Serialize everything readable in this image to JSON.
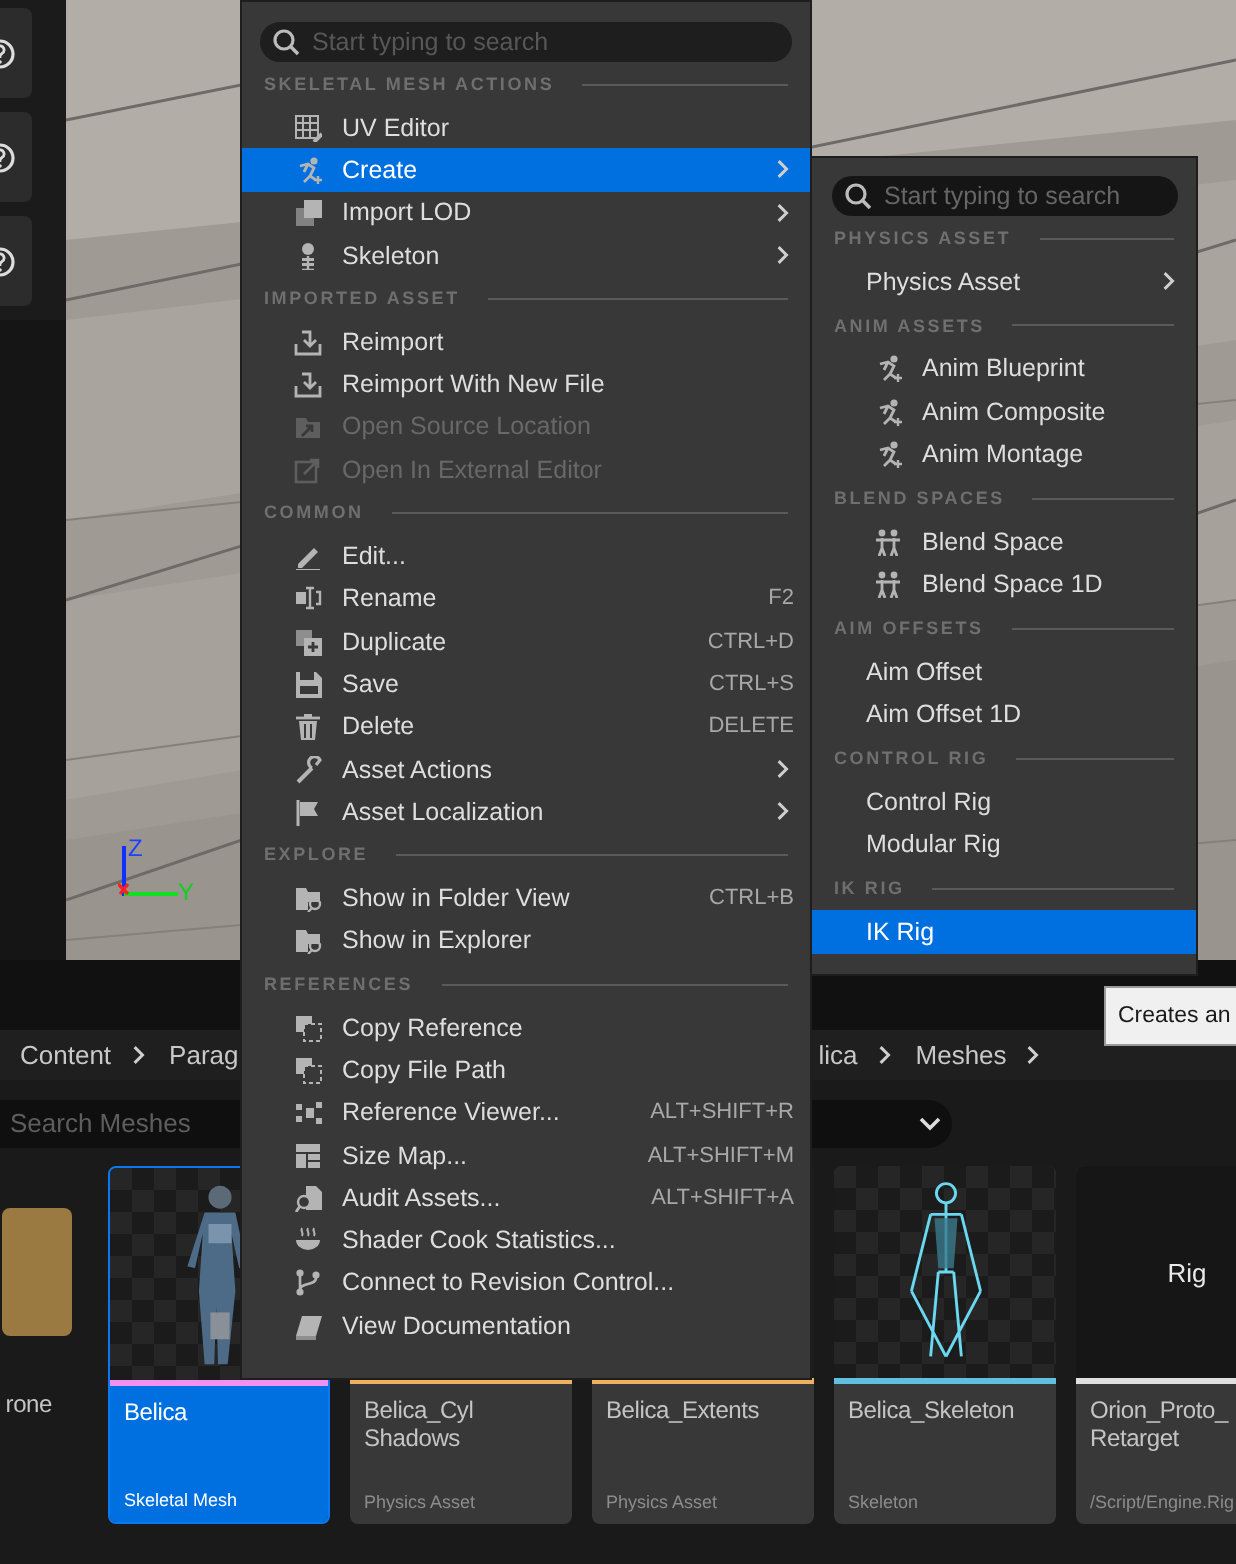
{
  "viewport": {
    "kind": "picture",
    "axis_labels": [
      "Z",
      "Y"
    ]
  },
  "tooltip": "Creates an",
  "breadcrumb": [
    {
      "label": "Content",
      "chevron": true
    },
    {
      "label": "Parag",
      "chevron": false
    },
    {
      "label": "lica",
      "chevron": true
    },
    {
      "label": "Meshes",
      "chevron": true
    }
  ],
  "search": {
    "placeholder": "Search Meshes"
  },
  "assets": [
    {
      "name": "rone",
      "selected": false,
      "thumbnail": {
        "kind": "swatch"
      }
    },
    {
      "name": "Belica",
      "type": "Skeletal Mesh",
      "color": "#f090f0",
      "selected": true,
      "thumbnail": {
        "kind": "figure"
      }
    },
    {
      "name": "Belica_Cyl Shadows",
      "type": "Physics Asset",
      "color": "#f0b060",
      "selected": false,
      "thumbnail": {
        "kind": "hidden"
      }
    },
    {
      "name": "Belica_Extents",
      "type": "Physics Asset",
      "color": "#f0b060",
      "selected": false,
      "thumbnail": {
        "kind": "hidden"
      }
    },
    {
      "name": "Belica_Skeleton",
      "type": "Skeleton",
      "color": "#60c0e0",
      "selected": false,
      "thumbnail": {
        "kind": "skeleton"
      }
    },
    {
      "name": "Orion_Proto_ Retarget",
      "type": "/Script/Engine.Rig",
      "color": "#e0e0e0",
      "selected": false,
      "thumbnail": {
        "kind": "text",
        "text": "Rig"
      }
    }
  ],
  "context_menu": {
    "search": {
      "placeholder": "Start typing to search"
    },
    "sections": [
      {
        "title": "SKELETAL MESH ACTIONS",
        "items": [
          {
            "label": "UV Editor",
            "submenu": false,
            "disabled": false,
            "selected": false
          },
          {
            "label": "Create",
            "submenu": true,
            "disabled": false,
            "selected": true
          },
          {
            "label": "Import LOD",
            "submenu": true,
            "disabled": false,
            "selected": false
          },
          {
            "label": "Skeleton",
            "submenu": true,
            "disabled": false,
            "selected": false
          }
        ]
      },
      {
        "title": "IMPORTED ASSET",
        "items": [
          {
            "label": "Reimport",
            "submenu": false,
            "disabled": false,
            "selected": false
          },
          {
            "label": "Reimport With New File",
            "submenu": false,
            "disabled": false,
            "selected": false
          },
          {
            "label": "Open Source Location",
            "submenu": false,
            "disabled": true,
            "selected": false
          },
          {
            "label": "Open In External Editor",
            "submenu": false,
            "disabled": true,
            "selected": false
          }
        ]
      },
      {
        "title": "COMMON",
        "items": [
          {
            "label": "Edit...",
            "submenu": false,
            "disabled": false,
            "selected": false
          },
          {
            "label": "Rename",
            "shortcut": "F2",
            "submenu": false,
            "disabled": false,
            "selected": false
          },
          {
            "label": "Duplicate",
            "shortcut": "CTRL+D",
            "submenu": false,
            "disabled": false,
            "selected": false
          },
          {
            "label": "Save",
            "shortcut": "CTRL+S",
            "submenu": false,
            "disabled": false,
            "selected": false
          },
          {
            "label": "Delete",
            "shortcut": "DELETE",
            "submenu": false,
            "disabled": false,
            "selected": false
          },
          {
            "label": "Asset Actions",
            "submenu": true,
            "disabled": false,
            "selected": false
          },
          {
            "label": "Asset Localization",
            "submenu": true,
            "disabled": false,
            "selected": false
          }
        ]
      },
      {
        "title": "EXPLORE",
        "items": [
          {
            "label": "Show in Folder View",
            "shortcut": "CTRL+B",
            "submenu": false,
            "disabled": false,
            "selected": false
          },
          {
            "label": "Show in Explorer",
            "submenu": false,
            "disabled": false,
            "selected": false
          }
        ]
      },
      {
        "title": "REFERENCES",
        "items": [
          {
            "label": "Copy Reference",
            "submenu": false,
            "disabled": false,
            "selected": false
          },
          {
            "label": "Copy File Path",
            "submenu": false,
            "disabled": false,
            "selected": false
          },
          {
            "label": "Reference Viewer...",
            "shortcut": "ALT+SHIFT+R",
            "submenu": false,
            "disabled": false,
            "selected": false
          },
          {
            "label": "Size Map...",
            "shortcut": "ALT+SHIFT+M",
            "submenu": false,
            "disabled": false,
            "selected": false
          },
          {
            "label": "Audit Assets...",
            "shortcut": "ALT+SHIFT+A",
            "submenu": false,
            "disabled": false,
            "selected": false
          },
          {
            "label": "Shader Cook Statistics...",
            "submenu": false,
            "disabled": false,
            "selected": false
          },
          {
            "label": "Connect to Revision Control...",
            "submenu": false,
            "disabled": false,
            "selected": false
          },
          {
            "label": "View Documentation",
            "submenu": false,
            "disabled": false,
            "selected": false
          }
        ]
      }
    ]
  },
  "submenu": {
    "search": {
      "placeholder": "Start typing to search"
    },
    "sections": [
      {
        "title": "PHYSICS ASSET",
        "items": [
          {
            "label": "Physics Asset",
            "kind": "plain",
            "submenu": true,
            "selected": false
          }
        ]
      },
      {
        "title": "ANIM ASSETS",
        "items": [
          {
            "label": "Anim Blueprint",
            "kind": "icon",
            "submenu": false,
            "selected": false
          },
          {
            "label": "Anim Composite",
            "kind": "icon",
            "submenu": false,
            "selected": false
          },
          {
            "label": "Anim Montage",
            "kind": "icon",
            "submenu": false,
            "selected": false
          }
        ]
      },
      {
        "title": "BLEND SPACES",
        "items": [
          {
            "label": "Blend Space",
            "kind": "icon",
            "submenu": false,
            "selected": false
          },
          {
            "label": "Blend Space 1D",
            "kind": "icon",
            "submenu": false,
            "selected": false
          }
        ]
      },
      {
        "title": "AIM OFFSETS",
        "items": [
          {
            "label": "Aim Offset",
            "kind": "plain",
            "submenu": false,
            "selected": false
          },
          {
            "label": "Aim Offset 1D",
            "kind": "plain",
            "submenu": false,
            "selected": false
          }
        ]
      },
      {
        "title": "CONTROL RIG",
        "items": [
          {
            "label": "Control Rig",
            "kind": "plain",
            "submenu": false,
            "selected": false
          },
          {
            "label": "Modular Rig",
            "kind": "plain",
            "submenu": false,
            "selected": false
          }
        ]
      },
      {
        "title": "IK RIG",
        "items": [
          {
            "label": "IK Rig",
            "kind": "plain",
            "submenu": false,
            "selected": true
          }
        ]
      }
    ]
  }
}
